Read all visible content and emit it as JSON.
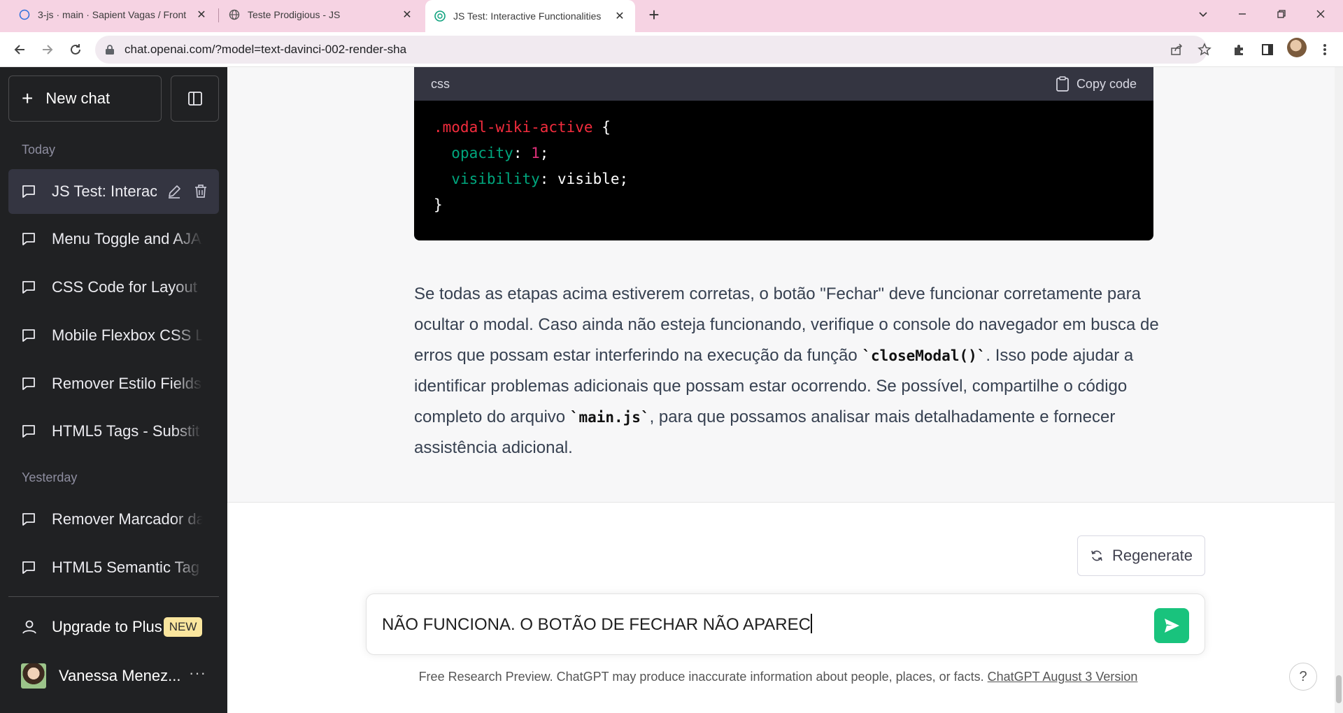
{
  "browser": {
    "tabs": [
      {
        "title": "3-js · main · Sapient Vagas / Front",
        "icon": "loading-circle-icon"
      },
      {
        "title": "Teste Prodigious - JS",
        "icon": "globe-icon"
      },
      {
        "title": "JS Test: Interactive Functionalities",
        "icon": "openai-icon"
      }
    ],
    "url": "chat.openai.com/?model=text-davinci-002-render-sha",
    "new_tab_label": "+"
  },
  "sidebar": {
    "new_chat_label": "New chat",
    "today_label": "Today",
    "yesterday_label": "Yesterday",
    "today_items": [
      "JS Test: Interac",
      "Menu Toggle and AJAX",
      "CSS Code for Layout",
      "Mobile Flexbox CSS L",
      "Remover Estilo Fields",
      "HTML5 Tags - Substit"
    ],
    "yesterday_items": [
      "Remover Marcador da",
      "HTML5 Semantic Tag"
    ],
    "upgrade_label": "Upgrade to Plus",
    "upgrade_badge": "NEW",
    "user_name": "Vanessa Menez...",
    "user_more": "···"
  },
  "main": {
    "code": {
      "language": "css",
      "copy_label": "Copy code",
      "selector": ".modal-wiki-active",
      "open_brace": "{",
      "close_brace": "}",
      "line1_prop": "opacity",
      "line1_value": "1",
      "line2_prop": "visibility",
      "line2_value": "visible"
    },
    "answer": {
      "part1": "Se todas as etapas acima estiverem corretas, o botão \"Fechar\" deve funcionar corretamente para ocultar o modal. Caso ainda não esteja funcionando, verifique o console do navegador em busca de erros que possam estar interferindo na execução da função ",
      "code1": "`closeModal()`",
      "part2": ". Isso pode ajudar a identificar problemas adicionais que possam estar ocorrendo. Se possível, compartilhe o código completo do arquivo ",
      "code2": "`main.js`",
      "part3": ", para que possamos analisar mais detalhadamente e fornecer assistência adicional."
    },
    "regenerate_label": "Regenerate",
    "input_value": "NÃO FUNCIONA. O BOTÃO DE FECHAR NÃO APAREC",
    "disclaimer_text": "Free Research Preview. ChatGPT may produce inaccurate information about people, places, or facts. ",
    "disclaimer_link": "ChatGPT August 3 Version",
    "help_label": "?"
  },
  "colors": {
    "sidebar_bg": "#202123",
    "send_button": "#19c37d",
    "tabbar_bg": "#f6d3e3"
  }
}
